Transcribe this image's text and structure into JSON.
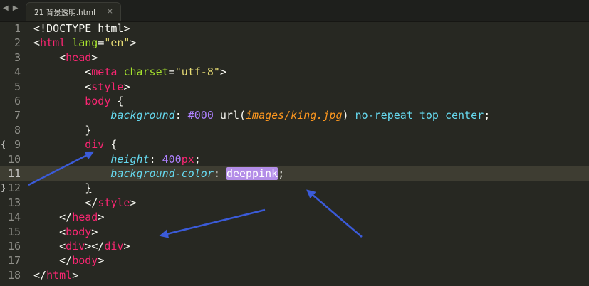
{
  "colors": {
    "background": "#272822",
    "tag": "#f92672",
    "attribute": "#a6e22e",
    "string": "#e6db74",
    "property": "#66d9ef",
    "number": "#ae81ff",
    "selection": "#b48ee8",
    "arrow": "#3b5bd9"
  },
  "tabbar": {
    "back_icon": "◀",
    "forward_icon": "▶",
    "tab_label": "21 背景透明.html",
    "close_icon": "×"
  },
  "editor": {
    "current_line": 11,
    "fold_markers": {
      "9": "{",
      "12": "}"
    },
    "lines": [
      {
        "num": "1",
        "parts": [
          {
            "t": "<!DOCTYPE html>",
            "c": ""
          }
        ]
      },
      {
        "num": "2",
        "parts": [
          {
            "t": "<",
            "c": ""
          },
          {
            "t": "html",
            "c": "t"
          },
          {
            "t": " ",
            "c": ""
          },
          {
            "t": "lang",
            "c": "a"
          },
          {
            "t": "=",
            "c": ""
          },
          {
            "t": "\"en\"",
            "c": "s"
          },
          {
            "t": ">",
            "c": ""
          }
        ]
      },
      {
        "num": "3",
        "parts": [
          {
            "t": "    <",
            "c": ""
          },
          {
            "t": "head",
            "c": "t"
          },
          {
            "t": ">",
            "c": ""
          }
        ]
      },
      {
        "num": "4",
        "parts": [
          {
            "t": "        <",
            "c": ""
          },
          {
            "t": "meta",
            "c": "t"
          },
          {
            "t": " ",
            "c": ""
          },
          {
            "t": "charset",
            "c": "a"
          },
          {
            "t": "=",
            "c": ""
          },
          {
            "t": "\"utf-8\"",
            "c": "s"
          },
          {
            "t": ">",
            "c": ""
          }
        ]
      },
      {
        "num": "5",
        "parts": [
          {
            "t": "        <",
            "c": ""
          },
          {
            "t": "style",
            "c": "t"
          },
          {
            "t": ">",
            "c": ""
          }
        ]
      },
      {
        "num": "6",
        "parts": [
          {
            "t": "        ",
            "c": ""
          },
          {
            "t": "body",
            "c": "t"
          },
          {
            "t": " {",
            "c": ""
          }
        ]
      },
      {
        "num": "7",
        "parts": [
          {
            "t": "            ",
            "c": ""
          },
          {
            "t": "background",
            "c": "p"
          },
          {
            "t": ": ",
            "c": ""
          },
          {
            "t": "#000",
            "c": "n"
          },
          {
            "t": " url(",
            "c": ""
          },
          {
            "t": "images/king.jpg",
            "c": "u"
          },
          {
            "t": ") ",
            "c": ""
          },
          {
            "t": "no-repeat",
            "c": "k"
          },
          {
            "t": " ",
            "c": ""
          },
          {
            "t": "top",
            "c": "k"
          },
          {
            "t": " ",
            "c": ""
          },
          {
            "t": "center",
            "c": "k"
          },
          {
            "t": ";",
            "c": ""
          }
        ]
      },
      {
        "num": "8",
        "parts": [
          {
            "t": "        }",
            "c": ""
          }
        ]
      },
      {
        "num": "9",
        "parts": [
          {
            "t": "        ",
            "c": ""
          },
          {
            "t": "div",
            "c": "t"
          },
          {
            "t": " ",
            "c": ""
          },
          {
            "t": "{",
            "c": "brace-ul"
          }
        ]
      },
      {
        "num": "10",
        "parts": [
          {
            "t": "            ",
            "c": ""
          },
          {
            "t": "height",
            "c": "p"
          },
          {
            "t": ": ",
            "c": ""
          },
          {
            "t": "400",
            "c": "n"
          },
          {
            "t": "px",
            "c": "t"
          },
          {
            "t": ";",
            "c": ""
          }
        ]
      },
      {
        "num": "11",
        "parts": [
          {
            "t": "            ",
            "c": ""
          },
          {
            "t": "background-color",
            "c": "p"
          },
          {
            "t": ": ",
            "c": ""
          },
          {
            "t": "deeppink",
            "c": "sel"
          },
          {
            "t": ";",
            "c": ""
          }
        ]
      },
      {
        "num": "12",
        "parts": [
          {
            "t": "        ",
            "c": ""
          },
          {
            "t": "}",
            "c": "brace-ul"
          }
        ]
      },
      {
        "num": "13",
        "parts": [
          {
            "t": "        </",
            "c": ""
          },
          {
            "t": "style",
            "c": "t"
          },
          {
            "t": ">",
            "c": ""
          }
        ]
      },
      {
        "num": "14",
        "parts": [
          {
            "t": "    </",
            "c": ""
          },
          {
            "t": "head",
            "c": "t"
          },
          {
            "t": ">",
            "c": ""
          }
        ]
      },
      {
        "num": "15",
        "parts": [
          {
            "t": "    <",
            "c": ""
          },
          {
            "t": "body",
            "c": "t"
          },
          {
            "t": ">",
            "c": ""
          }
        ]
      },
      {
        "num": "16",
        "parts": [
          {
            "t": "    <",
            "c": ""
          },
          {
            "t": "div",
            "c": "t"
          },
          {
            "t": "></",
            "c": ""
          },
          {
            "t": "div",
            "c": "t"
          },
          {
            "t": ">",
            "c": ""
          }
        ]
      },
      {
        "num": "17",
        "parts": [
          {
            "t": "    </",
            "c": ""
          },
          {
            "t": "body",
            "c": "t"
          },
          {
            "t": ">",
            "c": ""
          }
        ]
      },
      {
        "num": "18",
        "parts": [
          {
            "t": "</",
            "c": ""
          },
          {
            "t": "html",
            "c": "t"
          },
          {
            "t": ">",
            "c": ""
          }
        ]
      }
    ]
  }
}
